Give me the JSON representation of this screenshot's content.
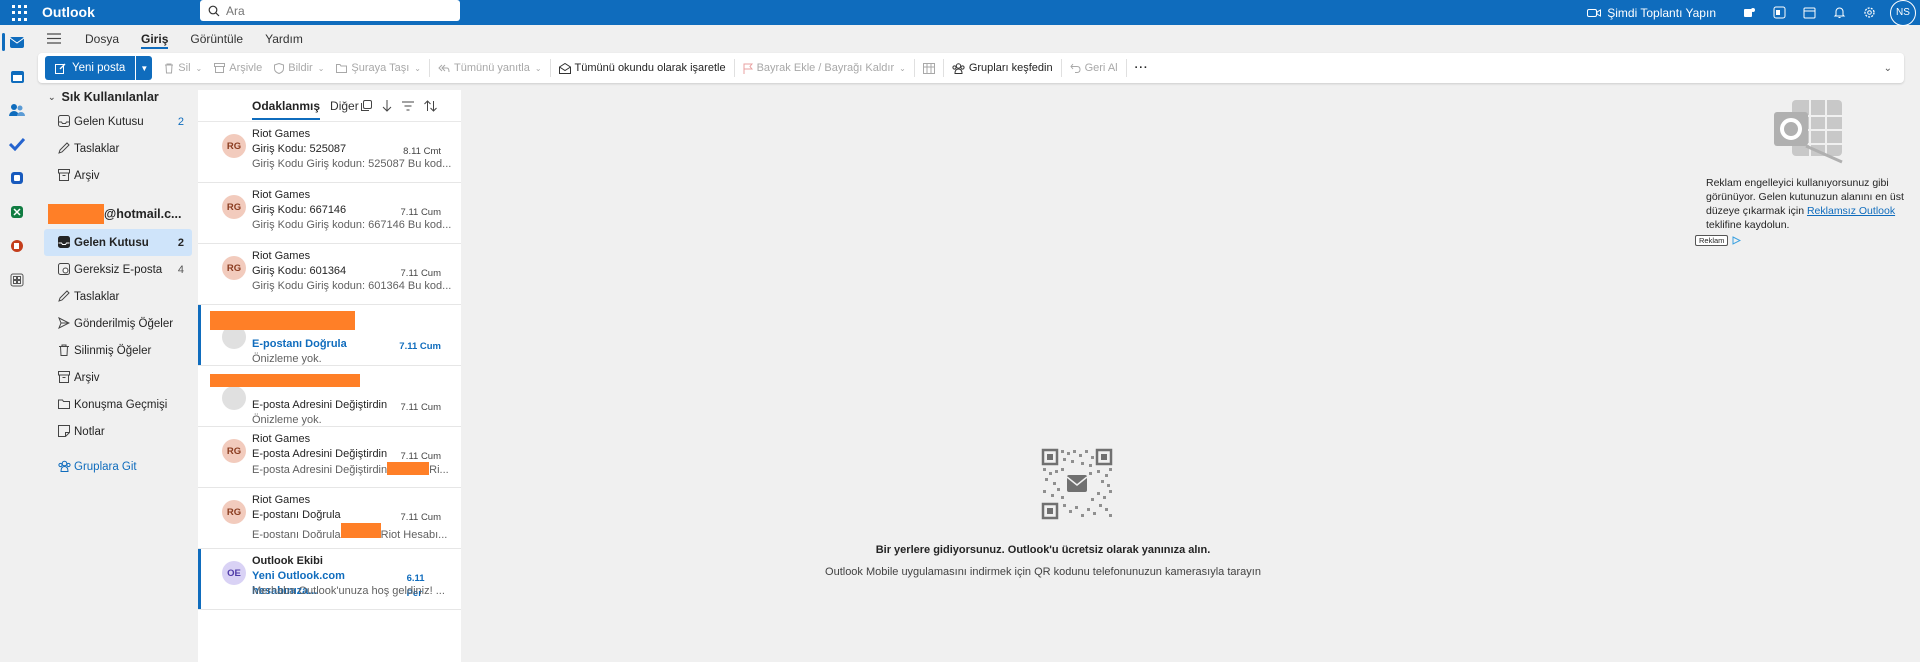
{
  "app": {
    "title": "Outlook"
  },
  "search": {
    "placeholder": "Ara"
  },
  "topbar": {
    "meet_label": "Şimdi Toplantı Yapın",
    "avatar_initials": "NS"
  },
  "menu": {
    "tabs": [
      "Dosya",
      "Giriş",
      "Görüntüle",
      "Yardım"
    ],
    "active": "Giriş"
  },
  "ribbon": {
    "new_mail": "Yeni posta",
    "delete": "Sil",
    "archive": "Arşivle",
    "report": "Bildir",
    "move": "Şuraya Taşı",
    "reply_all": "Tümünü yanıtla",
    "mark_all_read": "Tümünü okundu olarak işaretle",
    "flag": "Bayrak Ekle / Bayrağı Kaldır",
    "groups": "Grupları keşfedin",
    "undo": "Geri Al",
    "more": "···"
  },
  "folders": {
    "favorites_header": "Sık Kullanılanlar",
    "favorites": [
      {
        "label": "Gelen Kutusu",
        "count": "2",
        "icon": "inbox-icon"
      },
      {
        "label": "Taslaklar",
        "count": "",
        "icon": "draft-icon"
      },
      {
        "label": "Arşiv",
        "count": "",
        "icon": "archive-icon"
      }
    ],
    "account": "@hotmail.c...",
    "account_items": [
      {
        "label": "Gelen Kutusu",
        "count": "2",
        "icon": "inbox-icon"
      },
      {
        "label": "Gereksiz E-posta",
        "count": "4",
        "icon": "junk-icon"
      },
      {
        "label": "Taslaklar",
        "count": "",
        "icon": "draft-icon"
      },
      {
        "label": "Gönderilmiş Öğeler",
        "count": "",
        "icon": "sent-icon"
      },
      {
        "label": "Silinmiş Öğeler",
        "count": "",
        "icon": "trash-icon"
      },
      {
        "label": "Arşiv",
        "count": "",
        "icon": "archive-icon"
      },
      {
        "label": "Konuşma Geçmişi",
        "count": "",
        "icon": "folder-icon"
      },
      {
        "label": "Notlar",
        "count": "",
        "icon": "notes-icon"
      }
    ],
    "groups_link": "Gruplara Git"
  },
  "list": {
    "tab_focused": "Odaklanmış",
    "tab_other": "Diğer",
    "messages": [
      {
        "initials": "RG",
        "sender": "Riot Games",
        "subject": "Giriş Kodu: 525087",
        "date": "8.11 Cmt",
        "preview": "Giriş Kodu Giriş kodun: 525087 Bu kod..."
      },
      {
        "initials": "RG",
        "sender": "Riot Games",
        "subject": "Giriş Kodu: 667146",
        "date": "7.11 Cum",
        "preview": "Giriş Kodu Giriş kodun: 667146 Bu kod..."
      },
      {
        "initials": "RG",
        "sender": "Riot Games",
        "subject": "Giriş Kodu: 601364",
        "date": "7.11 Cum",
        "preview": "Giriş Kodu Giriş kodun: 601364 Bu kod..."
      },
      {
        "initials": "",
        "sender": "",
        "subject": "E-postanı Doğrula",
        "date": "7.11 Cum",
        "preview": "Önizleme yok."
      },
      {
        "initials": "",
        "sender": "",
        "subject": "E-posta Adresini Değiştirdin",
        "date": "7.11 Cum",
        "preview": "Önizleme yok."
      },
      {
        "initials": "RG",
        "sender": "Riot Games",
        "subject": "E-posta Adresini Değiştirdin",
        "date": "7.11 Cum",
        "preview": "E-posta Adresini Değiştirdin",
        "preview_tail": "Ri..."
      },
      {
        "initials": "RG",
        "sender": "Riot Games",
        "subject": "E-postanı Doğrula",
        "date": "7.11 Cum",
        "preview": "E-postanı Doğrula",
        "preview_tail": "Riot Hesabı..."
      },
      {
        "initials": "OE",
        "sender": "Outlook Ekibi",
        "subject": "Yeni Outlook.com hesabınıza...",
        "date": "6.11 Per",
        "preview": "Merhaba Outlook'unuza hoş geldiniz! ..."
      }
    ]
  },
  "reading": {
    "ad_text_1": "Reklam engelleyici kullanıyorsunuz gibi görünüyor. Gelen kutunuzun alanını en üst düzeye çıkarmak için ",
    "ad_link": "Reklamsız Outlook",
    "ad_text_2": " teklifine kaydolun.",
    "ad_badge": "Reklam",
    "qr_title": "Bir yerlere gidiyorsunuz. Outlook'u ücretsiz olarak yanınıza alın.",
    "qr_subtitle": "Outlook Mobile uygulamasını indirmek için QR kodunu telefonunuzun kamerasıyla tarayın"
  },
  "colors": {
    "brand": "#0f6cbd",
    "redaction": "#ff7f27",
    "selected": "#cfe4fa"
  }
}
